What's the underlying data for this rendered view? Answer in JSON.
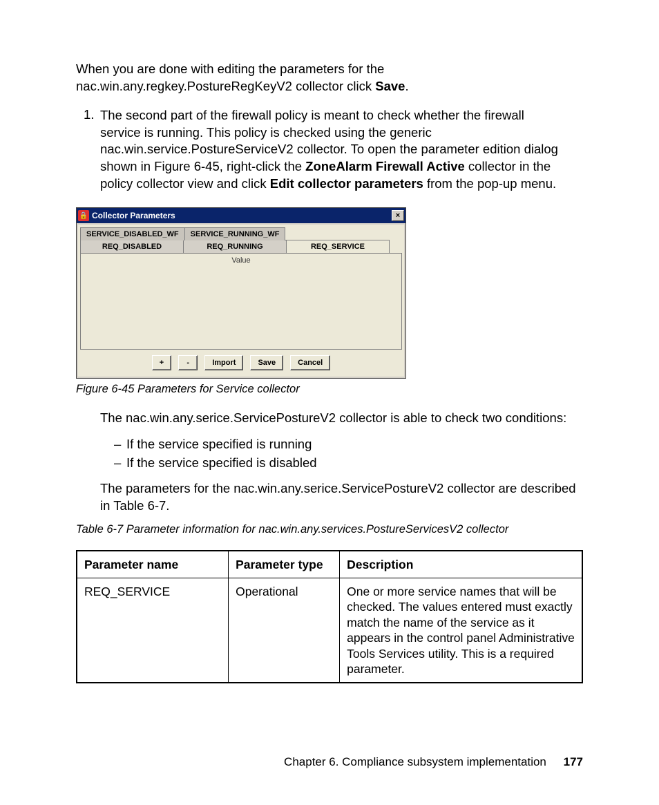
{
  "para1_a": "When you are done with editing the parameters for the nac.win.any.regkey.PostureRegKeyV2 collector click ",
  "para1_b": "Save",
  "para1_c": ".",
  "list1_num": "1.",
  "list1_a": "The second part of the firewall policy is meant to check whether the firewall service is running. This policy is checked using the generic nac.win.service.PostureServiceV2 collector. To open the parameter edition dialog shown in Figure 6-45, right-click the ",
  "list1_b": "ZoneAlarm Firewall Active",
  "list1_c": " collector in the policy collector view and click ",
  "list1_d": "Edit collector parameters",
  "list1_e": " from the pop-up menu.",
  "dlg": {
    "title": "Collector Parameters",
    "close": "×",
    "tabs_row1": [
      "SERVICE_DISABLED_WF",
      "SERVICE_RUNNING_WF"
    ],
    "tabs_row2": [
      "REQ_DISABLED",
      "REQ_RUNNING",
      "REQ_SERVICE"
    ],
    "value_hdr": "Value",
    "btn_plus": "+",
    "btn_minus": "-",
    "btn_import": "Import",
    "btn_save": "Save",
    "btn_cancel": "Cancel"
  },
  "fig_caption": "Figure 6-45   Parameters for Service collector",
  "para2": "The nac.win.any.serice.ServicePostureV2 collector is able to check two conditions:",
  "dash1": "If the service specified is running",
  "dash2": "If the service specified is disabled",
  "para3": "The parameters for the nac.win.any.serice.ServicePostureV2 collector are described in Table 6-7.",
  "tbl_caption": "Table 6-7   Parameter information for nac.win.any.services.PostureServicesV2 collector",
  "tbl": {
    "h1": "Parameter name",
    "h2": "Parameter type",
    "h3": "Description",
    "r1c1": "REQ_SERVICE",
    "r1c2": "Operational",
    "r1c3": "One or more service names that will be checked. The values entered must exactly match the name of the service as it appears in the control panel Administrative Tools Services utility. This is a required parameter."
  },
  "footer_text": "Chapter 6. Compliance subsystem implementation",
  "footer_page": "177"
}
